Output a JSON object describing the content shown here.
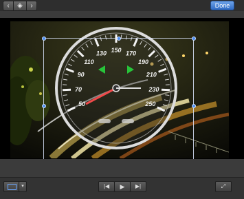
{
  "toolbar": {
    "prev_icon": "‹",
    "transition_icon": "◈",
    "next_icon": "›",
    "done_label": "Done"
  },
  "viewer": {
    "gauge_speeds": [
      "50",
      "70",
      "90",
      "110",
      "130",
      "150",
      "170",
      "190",
      "210",
      "230",
      "250"
    ],
    "gauge_colors": {
      "ring": "#dcdcdc",
      "needle": "#f04a4a",
      "indicator": "#27c43a"
    }
  },
  "crop": {
    "handle_color": "#4d8ef0"
  },
  "playback": {
    "skip_back_icon": "|◀",
    "play_icon": "▶",
    "skip_forward_icon": "▶|",
    "fullscreen_icon": "⤢",
    "crop_menu_icon": "▾"
  }
}
